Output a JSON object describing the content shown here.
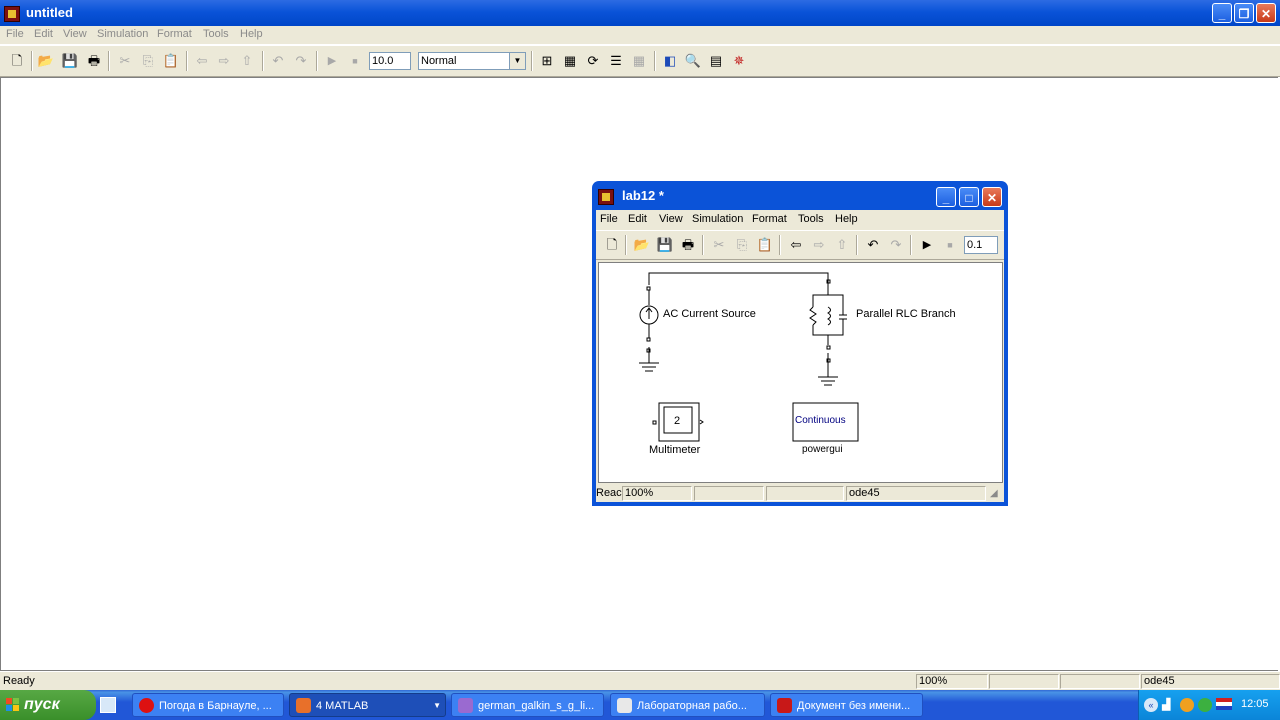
{
  "main": {
    "title": "untitled",
    "menu": [
      "File",
      "Edit",
      "View",
      "Simulation",
      "Format",
      "Tools",
      "Help"
    ],
    "stop_time": "10.0",
    "sim_mode": "Normal",
    "status": {
      "left": "Ready",
      "zoom": "100%",
      "empty1": "",
      "solver": "ode45"
    }
  },
  "lab": {
    "title": "lab12 *",
    "menu": [
      "File",
      "Edit",
      "View",
      "Simulation",
      "Format",
      "Tools",
      "Help"
    ],
    "stop_time": "0.1",
    "blocks": {
      "ac_source": "AC Current Source",
      "rlc": "Parallel RLC Branch",
      "multimeter_value": "2",
      "multimeter": "Multimeter",
      "powergui_value": "Continuous",
      "powergui": "powergui"
    },
    "status": {
      "left": "Reac",
      "zoom": "100%",
      "solver": "ode45"
    }
  },
  "taskbar": {
    "start": "пуск",
    "tasks": [
      {
        "label": "Погода в Барнауле, ..."
      },
      {
        "label": "4 MATLAB"
      },
      {
        "label": "german_galkin_s_g_li..."
      },
      {
        "label": "Лабораторная рабо..."
      },
      {
        "label": "Документ без имени..."
      }
    ],
    "clock": "12:05"
  },
  "colors": {
    "xp_blue": "#0b53d8",
    "face": "#ece9d8",
    "block_text": "#000080"
  }
}
